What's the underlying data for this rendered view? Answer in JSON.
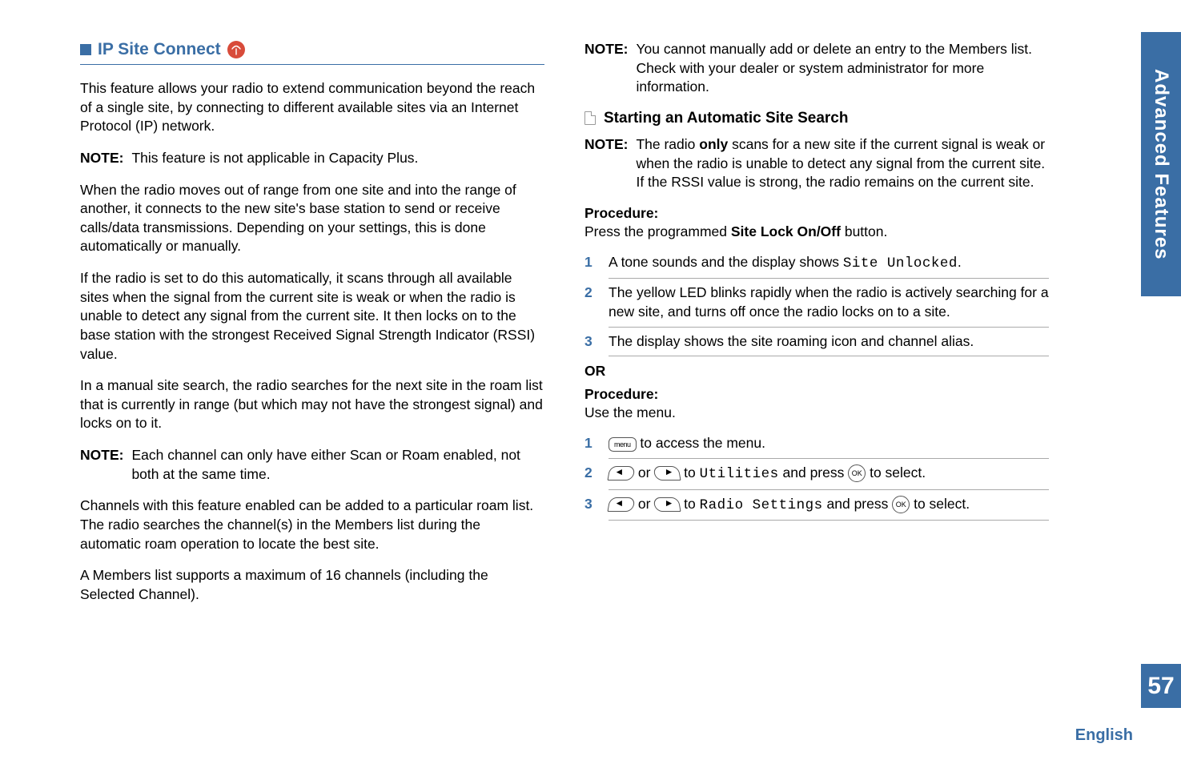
{
  "side_tab": "Advanced Features",
  "page_number": "57",
  "language": "English",
  "left": {
    "heading": "IP Site Connect",
    "antenna_glyph": "📡",
    "p1": "This feature allows your radio to extend communication beyond the reach of a single site, by connecting to different available sites via an Internet Protocol (IP) network.",
    "note1_label": "NOTE:",
    "note1": "This feature is not applicable in Capacity Plus.",
    "p2": "When the radio moves out of range from one site and into the range of another, it connects to the new site's base station to send or receive calls/data transmissions. Depending on your settings, this is done automatically or manually.",
    "p3": "If the radio is set to do this automatically, it scans through all available sites when the signal from the current site is weak or when the radio is unable to detect any signal from the current site. It then locks on to the base station with the strongest Received Signal Strength Indicator (RSSI) value.",
    "p4": "In a manual site search, the radio searches for the next site in the roam list that is currently in range (but which may not have the strongest signal) and locks on to it.",
    "note2_label": "NOTE:",
    "note2": "Each channel can only have either Scan or Roam enabled, not both at the same time.",
    "p5": "Channels with this feature enabled can be added to a particular roam list. The radio searches the channel(s) in the Members list during the automatic roam operation to locate the best site.",
    "p6": "A Members list supports a maximum of 16 channels (including the Selected Channel)."
  },
  "right": {
    "note_top_label": "NOTE:",
    "note_top": "You cannot manually add or delete an entry to the Members list. Check with your dealer or system administrator for more information.",
    "subheading": "Starting an Automatic Site Search",
    "note_scan_label": "NOTE:",
    "note_scan_pre": "The radio ",
    "note_scan_bold": "only",
    "note_scan_post": " scans for a new site if the current signal is weak or when the radio is unable to detect any signal from the current site. If the RSSI value is strong, the radio remains on the current site.",
    "proc1_label": "Procedure:",
    "proc1_desc_pre": "Press the programmed ",
    "proc1_desc_bold": "Site Lock On/Off",
    "proc1_desc_post": " button.",
    "step1_pre": "A tone sounds and the display shows ",
    "step1_mono": "Site Unlocked",
    "step1_post": ".",
    "step2": "The yellow LED blinks rapidly when the radio is actively searching for a new site, and turns off once the radio locks on to a site.",
    "step3": "The display shows the site roaming icon and channel alias.",
    "or": "OR",
    "proc2_label": "Procedure:",
    "proc2_desc": "Use the menu.",
    "m1": " to access the menu.",
    "m2_pre": " or ",
    "m2_mid": " to ",
    "m2_mono": "Utilities",
    "m2_post": " and press ",
    "m2_end": " to select.",
    "m3_pre": " or ",
    "m3_mid": " to ",
    "m3_mono": "Radio Settings",
    "m3_post": " and press ",
    "m3_end": " to select."
  }
}
